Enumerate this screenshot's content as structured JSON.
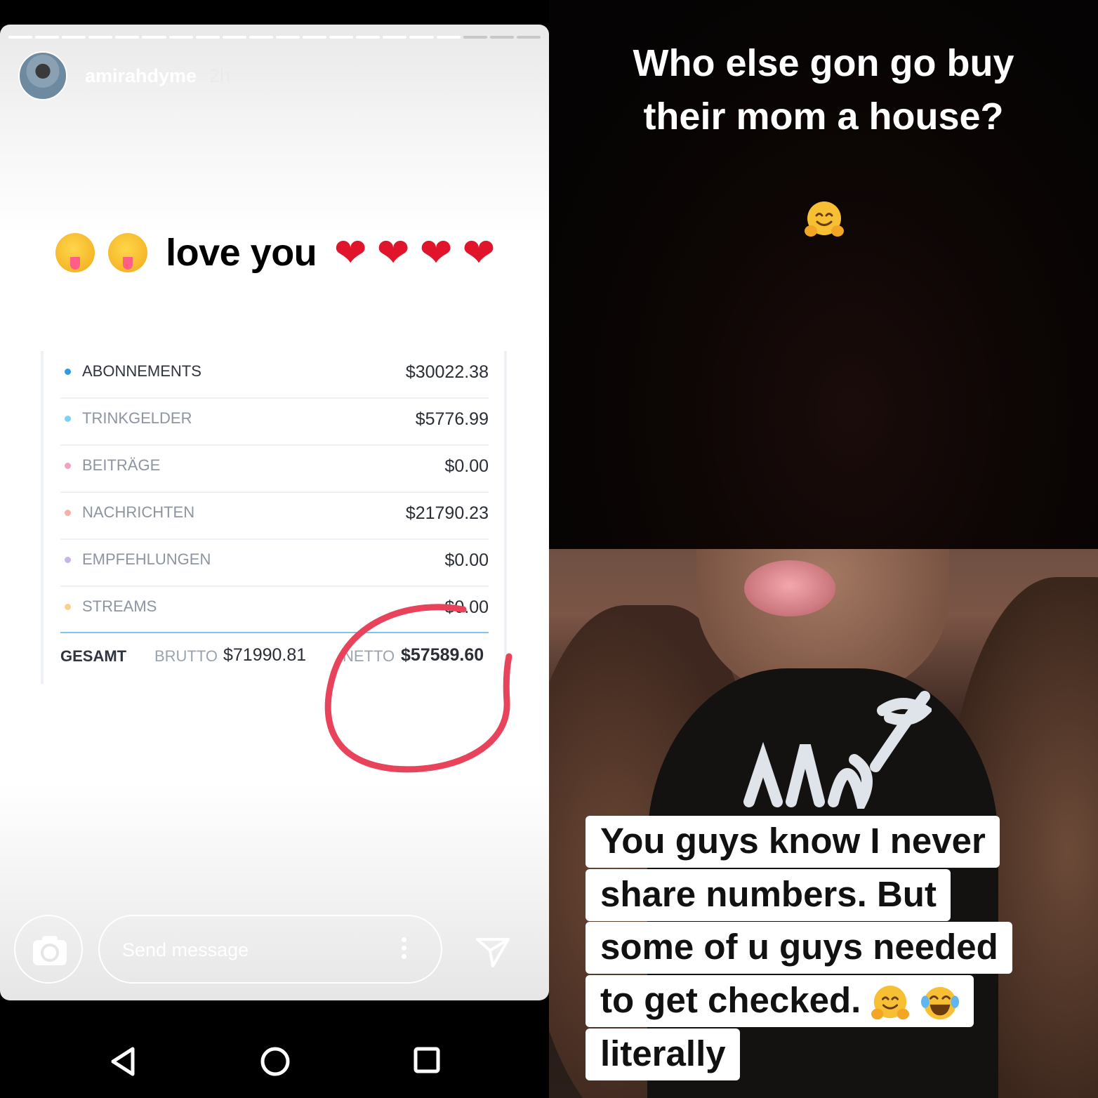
{
  "story": {
    "username": "amirahdyme",
    "time": "2h",
    "progress_total": 20,
    "progress_done": 17,
    "caption_text": "love you",
    "caption_faces": [
      "squinting-face-with-tongue",
      "squinting-face-with-tongue"
    ],
    "caption_hearts": [
      "red-heart",
      "red-heart",
      "red-heart",
      "red-heart"
    ]
  },
  "earnings": {
    "rows": [
      {
        "label": "ABONNEMENTS",
        "value": "$30022.38",
        "color": "#2d9be3"
      },
      {
        "label": "TRINKGELDER",
        "value": "$5776.99",
        "color": "#7fd1ef"
      },
      {
        "label": "BEITRÄGE",
        "value": "$0.00",
        "color": "#f2a0c4"
      },
      {
        "label": "NACHRICHTEN",
        "value": "$21790.23",
        "color": "#f3b2a8"
      },
      {
        "label": "EMPFEHLUNGEN",
        "value": "$0.00",
        "color": "#c6b4ec"
      },
      {
        "label": "STREAMS",
        "value": "$0.00",
        "color": "#f6d28c"
      }
    ],
    "total_label": "GESAMT",
    "brutto_label": "BRUTTO",
    "brutto_value": "$71990.81",
    "netto_label": "NETTO",
    "netto_value": "$57589.60"
  },
  "composer": {
    "placeholder": "Send message"
  },
  "right_top": {
    "line1": "Who else gon go buy",
    "line2": "their mom a house?",
    "emoji": "hugging-face"
  },
  "right_bottom": {
    "line1": "You guys know I never",
    "line2": "share numbers. But",
    "line3": "some of u guys needed",
    "line4": "to get checked.",
    "line5": "literally"
  },
  "colors": {
    "scribble": "#e8435a",
    "accent_line": "#7ec6e8"
  }
}
